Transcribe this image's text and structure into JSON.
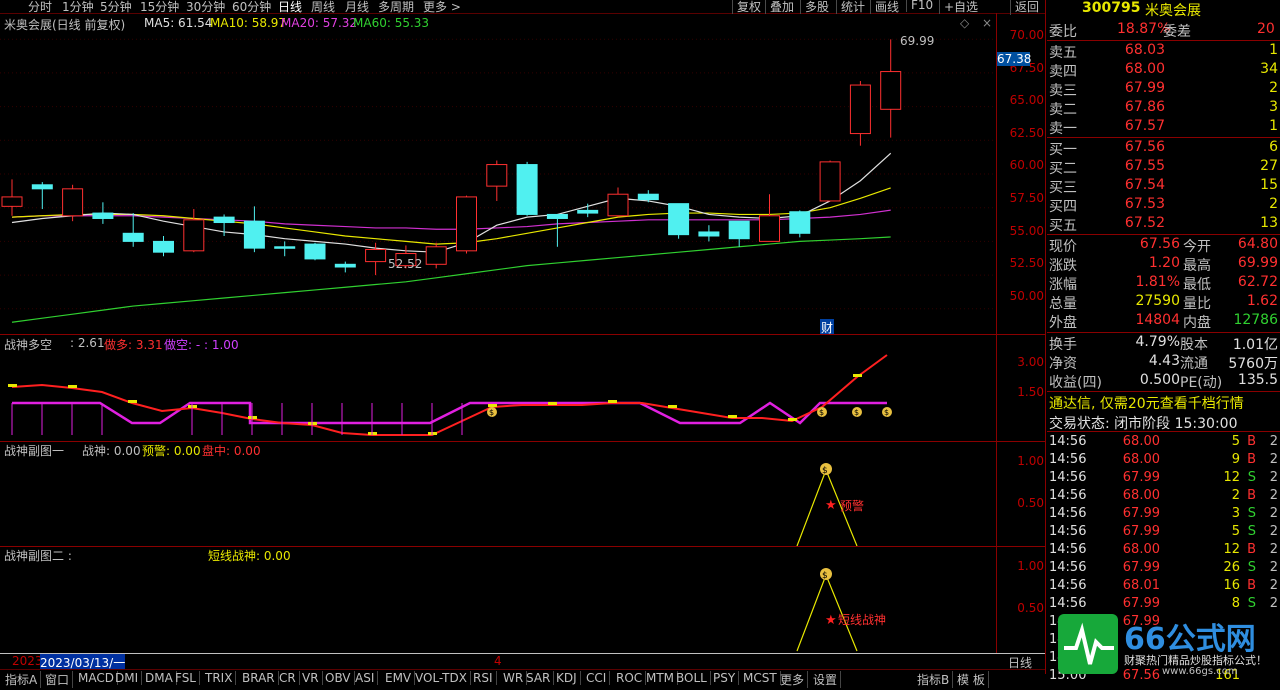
{
  "toolbar": {
    "tabs": [
      "分时",
      "1分钟",
      "5分钟",
      "15分钟",
      "30分钟",
      "60分钟",
      "日线",
      "周线",
      "月线",
      "多周期",
      "更多 >"
    ],
    "buttons": [
      "复权",
      "叠加",
      "多股",
      "统计",
      "画线",
      "F10",
      "+自选",
      "返回"
    ]
  },
  "main_panel": {
    "title": "米奥会展(日线 前复权)",
    "ma5": "MA5: 61.54",
    "ma10": "MA10: 58.97",
    "ma20": "MA20: 57.32",
    "ma60": "MA60: 55.33",
    "axis": [
      "70.00",
      "67.50",
      "65.00",
      "62.50",
      "60.00",
      "57.50",
      "55.00",
      "52.50",
      "50.00"
    ],
    "current_price": "67.38",
    "high_label": "69.99",
    "low_label": "52.52",
    "finance_marker": "财"
  },
  "panel1": {
    "title": "战神多空",
    "value": ": 2.61",
    "long_label": "做多: 3.31",
    "short_label": "做空: - : 1.00",
    "axis": [
      "3.00",
      "1.50"
    ]
  },
  "panel2": {
    "title": "战神副图一",
    "value": "战神: 0.00",
    "warn": "预警: 0.00",
    "mid": "盘中: 0.00",
    "axis": [
      "1.00",
      "0.50"
    ],
    "signal_text": "预警"
  },
  "panel3": {
    "title": "战神副图二 :",
    "value": "短线战神: 0.00",
    "axis": [
      "1.00",
      "0.50"
    ],
    "signal_text": "短线战神"
  },
  "timeline": {
    "year": "2023",
    "date": "2023/03/13/一",
    "mark": "4",
    "period": "日线"
  },
  "bottombar": [
    "指标A",
    "窗口",
    "MACD",
    "DMI",
    "DMA",
    "FSL",
    "TRIX",
    "BRAR",
    "CR",
    "VR",
    "OBV",
    "ASI",
    "EMV",
    "VOL-TDX",
    "RSI",
    "WR",
    "SAR",
    "KDJ",
    "CCI",
    "ROC",
    "MTM",
    "BOLL",
    "PSY",
    "MCST",
    "更多",
    "设置",
    "指标B",
    "模 板"
  ],
  "quote": {
    "code": "300795",
    "name": "米奥会展",
    "weibi_label": "委比",
    "weibi": "18.87%",
    "weicha_label": "委差",
    "weicha": "20",
    "asks": [
      {
        "label": "卖五",
        "price": "68.03",
        "vol": "1"
      },
      {
        "label": "卖四",
        "price": "68.00",
        "vol": "34"
      },
      {
        "label": "卖三",
        "price": "67.99",
        "vol": "2"
      },
      {
        "label": "卖二",
        "price": "67.86",
        "vol": "3"
      },
      {
        "label": "卖一",
        "price": "67.57",
        "vol": "1"
      }
    ],
    "bids": [
      {
        "label": "买一",
        "price": "67.56",
        "vol": "6"
      },
      {
        "label": "买二",
        "price": "67.55",
        "vol": "27"
      },
      {
        "label": "买三",
        "price": "67.54",
        "vol": "15"
      },
      {
        "label": "买四",
        "price": "67.53",
        "vol": "2"
      },
      {
        "label": "买五",
        "price": "67.52",
        "vol": "13"
      }
    ],
    "stats": [
      {
        "l1": "现价",
        "v1": "67.56",
        "l2": "今开",
        "v2": "64.80"
      },
      {
        "l1": "涨跌",
        "v1": "1.20",
        "l2": "最高",
        "v2": "69.99"
      },
      {
        "l1": "涨幅",
        "v1": "1.81%",
        "l2": "最低",
        "v2": "62.72"
      },
      {
        "l1": "总量",
        "v1": "27590",
        "l2": "量比",
        "v2": "1.62"
      },
      {
        "l1": "外盘",
        "v1": "14804",
        "l2": "内盘",
        "v2": "12786"
      }
    ],
    "stats2": [
      {
        "l1": "换手",
        "v1": "4.79%",
        "l2": "股本",
        "v2": "1.01亿"
      },
      {
        "l1": "净资",
        "v1": "4.43",
        "l2": "流通",
        "v2": "5760万"
      },
      {
        "l1": "收益(四)",
        "v1": "0.500",
        "l2": "PE(动)",
        "v2": "135.5"
      }
    ],
    "promo": "通达信, 仅需20元查看千档行情",
    "status": "交易状态: 闭市阶段 15:30:00",
    "ticks": [
      {
        "t": "14:56",
        "p": "68.00",
        "v": "5",
        "s": "B",
        "n": "2"
      },
      {
        "t": "14:56",
        "p": "68.00",
        "v": "9",
        "s": "B",
        "n": "2"
      },
      {
        "t": "14:56",
        "p": "67.99",
        "v": "12",
        "s": "S",
        "n": "2"
      },
      {
        "t": "14:56",
        "p": "68.00",
        "v": "2",
        "s": "B",
        "n": "2"
      },
      {
        "t": "14:56",
        "p": "67.99",
        "v": "3",
        "s": "S",
        "n": "2"
      },
      {
        "t": "14:56",
        "p": "67.99",
        "v": "5",
        "s": "S",
        "n": "2"
      },
      {
        "t": "14:56",
        "p": "68.00",
        "v": "12",
        "s": "B",
        "n": "2"
      },
      {
        "t": "14:56",
        "p": "67.99",
        "v": "26",
        "s": "S",
        "n": "2"
      },
      {
        "t": "14:56",
        "p": "68.01",
        "v": "16",
        "s": "B",
        "n": "2"
      },
      {
        "t": "14:56",
        "p": "67.99",
        "v": "8",
        "s": "S",
        "n": "2"
      },
      {
        "t": "14:56",
        "p": "67.99",
        "v": "",
        "s": "",
        "n": ""
      },
      {
        "t": "14:56",
        "p": "",
        "v": "",
        "s": "",
        "n": ""
      },
      {
        "t": "14:56",
        "p": "",
        "v": "",
        "s": "",
        "n": ""
      },
      {
        "t": "15:00",
        "p": "67.56",
        "v": "161",
        "s": "",
        "n": ""
      }
    ]
  },
  "watermark": {
    "brand": "66公式网",
    "line": "财聚热门精品炒股指标公式！",
    "url": "www.66gs.com"
  },
  "chart_data": {
    "type": "candlestick",
    "y_range": [
      48.5,
      71.5
    ],
    "candles": [
      {
        "o": 57.6,
        "c": 58.3,
        "h": 59.6,
        "l": 56.9
      },
      {
        "o": 59.2,
        "c": 58.9,
        "h": 59.4,
        "l": 57.4
      },
      {
        "o": 56.9,
        "c": 58.9,
        "h": 59.2,
        "l": 56.5
      },
      {
        "o": 57.1,
        "c": 56.7,
        "h": 57.9,
        "l": 56.3
      },
      {
        "o": 55.6,
        "c": 55.0,
        "h": 57.1,
        "l": 54.6
      },
      {
        "o": 55.0,
        "c": 54.2,
        "h": 55.4,
        "l": 53.9
      },
      {
        "o": 54.3,
        "c": 56.6,
        "h": 57.4,
        "l": 54.2
      },
      {
        "o": 56.8,
        "c": 56.4,
        "h": 57.0,
        "l": 55.4
      },
      {
        "o": 56.5,
        "c": 54.5,
        "h": 57.6,
        "l": 54.2
      },
      {
        "o": 54.6,
        "c": 54.5,
        "h": 55.0,
        "l": 53.9
      },
      {
        "o": 54.8,
        "c": 53.7,
        "h": 54.9,
        "l": 53.6
      },
      {
        "o": 53.3,
        "c": 53.1,
        "h": 53.5,
        "l": 52.7
      },
      {
        "o": 53.5,
        "c": 54.4,
        "h": 54.9,
        "l": 52.5
      },
      {
        "o": 53.2,
        "c": 54.1,
        "h": 54.7,
        "l": 53.0
      },
      {
        "o": 53.3,
        "c": 54.6,
        "h": 54.9,
        "l": 53.0
      },
      {
        "o": 54.3,
        "c": 58.3,
        "h": 58.4,
        "l": 54.1
      },
      {
        "o": 59.1,
        "c": 60.7,
        "h": 61.0,
        "l": 58.0
      },
      {
        "o": 60.7,
        "c": 57.0,
        "h": 60.9,
        "l": 56.9
      },
      {
        "o": 57.0,
        "c": 56.7,
        "h": 57.0,
        "l": 54.6
      },
      {
        "o": 57.3,
        "c": 57.1,
        "h": 57.8,
        "l": 56.8
      },
      {
        "o": 56.9,
        "c": 58.5,
        "h": 59.0,
        "l": 56.8
      },
      {
        "o": 58.5,
        "c": 58.1,
        "h": 58.8,
        "l": 57.9
      },
      {
        "o": 57.8,
        "c": 55.5,
        "h": 57.8,
        "l": 55.2
      },
      {
        "o": 55.7,
        "c": 55.4,
        "h": 56.2,
        "l": 55.0
      },
      {
        "o": 56.5,
        "c": 55.2,
        "h": 56.5,
        "l": 54.6
      },
      {
        "o": 55.0,
        "c": 56.9,
        "h": 58.5,
        "l": 55.0
      },
      {
        "o": 57.2,
        "c": 55.6,
        "h": 57.3,
        "l": 55.3
      },
      {
        "o": 58.0,
        "c": 60.9,
        "h": 61.0,
        "l": 58.0
      },
      {
        "o": 63.0,
        "c": 66.6,
        "h": 66.9,
        "l": 62.1
      },
      {
        "o": 64.8,
        "c": 67.6,
        "h": 69.99,
        "l": 62.7
      }
    ],
    "ma5": [
      56.4,
      56.7,
      56.9,
      57.1,
      57.0,
      56.5,
      56.1,
      55.7,
      55.5,
      55.2,
      55.0,
      54.8,
      54.5,
      54.3,
      54.2,
      54.9,
      56.2,
      56.8,
      57.0,
      57.6,
      58.2,
      58.0,
      57.6,
      57.0,
      56.8,
      56.7,
      56.9,
      58.0,
      59.5,
      61.54
    ],
    "ma10": [
      56.8,
      56.9,
      57.0,
      57.0,
      57.0,
      56.9,
      56.7,
      56.5,
      56.3,
      56.0,
      55.7,
      55.4,
      55.2,
      55.0,
      54.8,
      54.9,
      55.2,
      55.6,
      56.0,
      56.4,
      56.8,
      57.0,
      57.1,
      57.1,
      57.0,
      57.0,
      57.1,
      57.5,
      58.2,
      58.97
    ],
    "ma20": [
      56.8,
      56.9,
      56.9,
      56.9,
      56.9,
      56.8,
      56.7,
      56.6,
      56.5,
      56.3,
      56.2,
      56.1,
      56.0,
      56.0,
      55.9,
      55.9,
      56.0,
      56.1,
      56.3,
      56.4,
      56.5,
      56.6,
      56.6,
      56.6,
      56.6,
      56.6,
      56.7,
      56.8,
      57.0,
      57.32
    ],
    "ma60": [
      49.0,
      49.3,
      49.6,
      49.9,
      50.2,
      50.4,
      50.6,
      50.8,
      51.0,
      51.2,
      51.4,
      51.6,
      51.8,
      52.0,
      52.3,
      52.6,
      52.9,
      53.2,
      53.4,
      53.6,
      53.8,
      54.0,
      54.2,
      54.4,
      54.6,
      54.8,
      55.0,
      55.1,
      55.2,
      55.33
    ]
  }
}
